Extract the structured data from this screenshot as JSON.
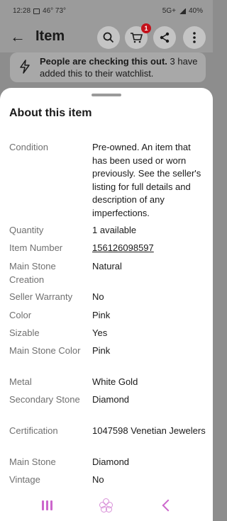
{
  "status_bar": {
    "time": "12:28",
    "weather": "46° 73°",
    "network": "5G+",
    "battery": "40%"
  },
  "header": {
    "title": "Item",
    "cart_count": "1"
  },
  "watch_banner": {
    "bold_text": "People are checking this out.",
    "text": " 3 have added this to their watchlist."
  },
  "sheet": {
    "title": "About this item",
    "specs": [
      {
        "label": "Condition",
        "value": "Pre-owned. An item that has been used or worn previously. See the seller's listing for full details and description of any imperfections."
      },
      {
        "label": "Quantity",
        "value": "1 available"
      },
      {
        "label": "Item Number",
        "value": "156126098597"
      },
      {
        "label": "Main Stone Creation",
        "value": "Natural"
      },
      {
        "label": "Seller Warranty",
        "value": "No"
      },
      {
        "label": "Color",
        "value": "Pink"
      },
      {
        "label": "Sizable",
        "value": "Yes"
      },
      {
        "label": "Main Stone Color",
        "value": "Pink"
      },
      {
        "label": "Metal",
        "value": "White Gold"
      },
      {
        "label": "Secondary Stone",
        "value": "Diamond"
      },
      {
        "label": "Certification",
        "value": "1047598 Venetian Jewelers"
      },
      {
        "label": "Main Stone",
        "value": "Diamond"
      },
      {
        "label": "Vintage",
        "value": "No"
      }
    ]
  }
}
